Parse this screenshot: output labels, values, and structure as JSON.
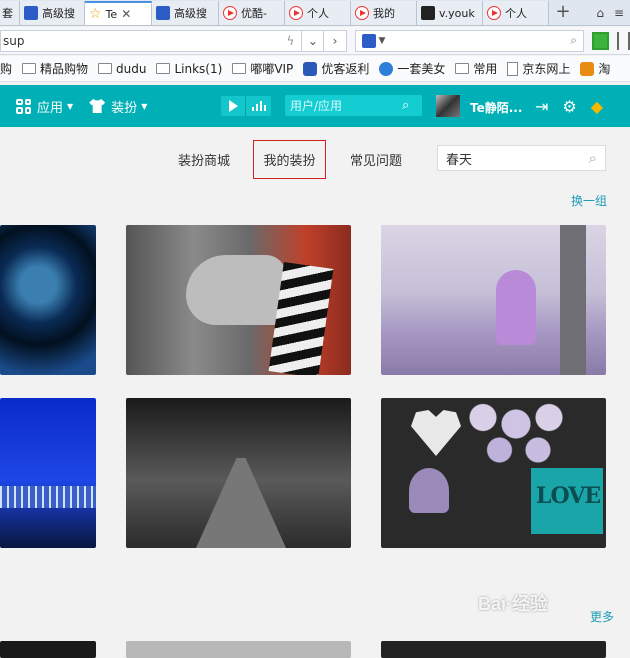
{
  "browser": {
    "tabs": [
      {
        "label": "套",
        "icon": "none",
        "active": false,
        "close": ""
      },
      {
        "label": "高级搜",
        "icon": "paw",
        "active": false,
        "close": ""
      },
      {
        "label": "Te",
        "icon": "star",
        "active": true,
        "close": "✕"
      },
      {
        "label": "高级搜",
        "icon": "paw",
        "active": false,
        "close": ""
      },
      {
        "label": "优酷-",
        "icon": "play",
        "active": false,
        "close": ""
      },
      {
        "label": "个人",
        "icon": "play",
        "active": false,
        "close": ""
      },
      {
        "label": "我的",
        "icon": "play",
        "active": false,
        "close": ""
      },
      {
        "label": "v.youk",
        "icon": "yk",
        "active": false,
        "close": ""
      },
      {
        "label": "个人",
        "icon": "play",
        "active": false,
        "close": ""
      }
    ],
    "new_tab": "+",
    "url": "sup",
    "bookmarks": [
      {
        "label": "购",
        "icon": "none"
      },
      {
        "label": "精品购物",
        "icon": "folder"
      },
      {
        "label": "dudu",
        "icon": "folder"
      },
      {
        "label": "Links(1)",
        "icon": "folder"
      },
      {
        "label": "嘟嘟VIP",
        "icon": "folder"
      },
      {
        "label": "优客返利",
        "icon": "shield"
      },
      {
        "label": "一套美女",
        "icon": "globe"
      },
      {
        "label": "常用",
        "icon": "folder"
      },
      {
        "label": "京东网上",
        "icon": "page"
      },
      {
        "label": "淘",
        "icon": "orange"
      }
    ]
  },
  "app": {
    "menu_apps": "应用",
    "menu_skin": "装扮",
    "user_search_placeholder": "用户/应用",
    "username": "Te静陌..."
  },
  "subnav": {
    "shop": "装扮商城",
    "mine": "我的装扮",
    "faq": "常见问题",
    "search_value": "春天"
  },
  "links": {
    "refresh": "换一组",
    "more": "更多"
  },
  "skins": [
    {
      "name": "skin-1"
    },
    {
      "name": "skin-2"
    },
    {
      "name": "skin-3"
    },
    {
      "name": "skin-4"
    },
    {
      "name": "skin-5"
    },
    {
      "name": "skin-6"
    }
  ],
  "card_love_text": "LOVE",
  "watermark": "Bai·经验",
  "colors": {
    "accent": "#00b0b6",
    "link": "#1e9cb8",
    "highlight_border": "#d02020"
  }
}
